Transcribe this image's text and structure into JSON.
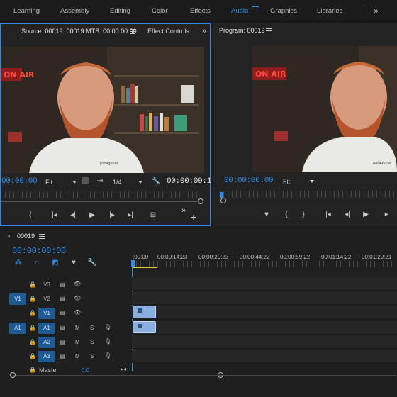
{
  "workspaces": {
    "items": [
      "Learning",
      "Assembly",
      "Editing",
      "Color",
      "Effects",
      "Audio",
      "Graphics",
      "Libraries"
    ],
    "active": "Audio",
    "overflow_icon": "double-chevron-right-icon"
  },
  "source_monitor": {
    "tab_source": "Source: 00019: 00019.MTS: 00:00:00:00",
    "tab_effects": "Effect Controls",
    "overflow": "»",
    "timecode": "00:00:00",
    "fit": "Fit",
    "quality": "1/4",
    "duration": "00:00:09:1"
  },
  "program_monitor": {
    "tab": "Program: 00019",
    "timecode": "00:00:00:00",
    "fit": "Fit"
  },
  "video": {
    "neon_sign": "ON AIR",
    "shirt_text": "patagonia"
  },
  "timeline": {
    "close": "×",
    "sequence_name": "00019",
    "timecode": "00:00:00:00",
    "ruler_labels": [
      ":00:00",
      "00:00:14:23",
      "00:00:29:23",
      "00:00:44:22",
      "00:00:59:22",
      "00:01:14:22",
      "00:01:29:21"
    ],
    "tracks": {
      "v3": "V3",
      "v2": "V2",
      "v1": "V1",
      "a1": "A1",
      "a2": "A2",
      "a3": "A3",
      "master": "Master",
      "master_value": "0.0",
      "src_v1": "V1",
      "src_a1": "A1",
      "mute": "M",
      "solo": "S"
    }
  },
  "colors": {
    "accent": "#2d8ceb",
    "panel": "#232323",
    "target_on": "#1f5a92",
    "clip": "#8aaede"
  }
}
